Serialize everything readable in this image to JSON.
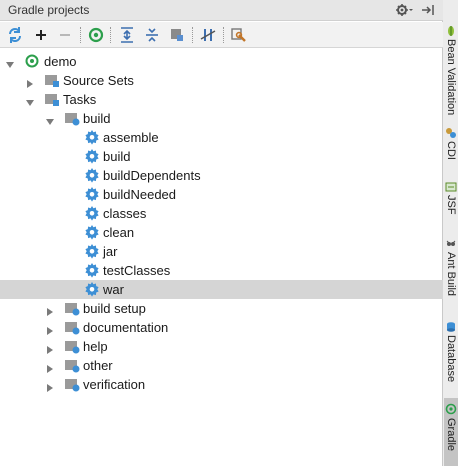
{
  "header": {
    "title": "Gradle projects"
  },
  "toolbar": {
    "buttons": [
      {
        "name": "refresh-all-icon"
      },
      {
        "name": "add-icon"
      },
      {
        "name": "remove-icon"
      },
      {
        "name": "execute-task-icon"
      },
      {
        "name": "expand-all-icon"
      },
      {
        "name": "collapse-all-icon"
      },
      {
        "name": "offline-mode-icon"
      },
      {
        "name": "toggle-offline-icon"
      },
      {
        "name": "settings-wrench-icon"
      }
    ]
  },
  "tree": {
    "root": "demo",
    "source_sets": "Source Sets",
    "tasks": "Tasks",
    "build_group": "build",
    "build_tasks": [
      "assemble",
      "build",
      "buildDependents",
      "buildNeeded",
      "classes",
      "clean",
      "jar",
      "testClasses",
      "war"
    ],
    "selected": "war",
    "other_groups": [
      "build setup",
      "documentation",
      "help",
      "other",
      "verification"
    ]
  },
  "sidebar": {
    "tabs": [
      {
        "label": "Bean Validation",
        "icon": "bean-validation-icon",
        "active": false
      },
      {
        "label": "CDI",
        "icon": "cdi-icon",
        "active": false
      },
      {
        "label": "JSF",
        "icon": "jsf-icon",
        "active": false
      },
      {
        "label": "Ant Build",
        "icon": "ant-build-icon",
        "active": false
      },
      {
        "label": "Database",
        "icon": "database-icon",
        "active": false
      },
      {
        "label": "Gradle",
        "icon": "gradle-icon",
        "active": true
      }
    ]
  },
  "colors": {
    "accent_blue": "#3d8fd5",
    "gradle_green": "#2c9f4c",
    "selection": "#d5d5d5"
  }
}
